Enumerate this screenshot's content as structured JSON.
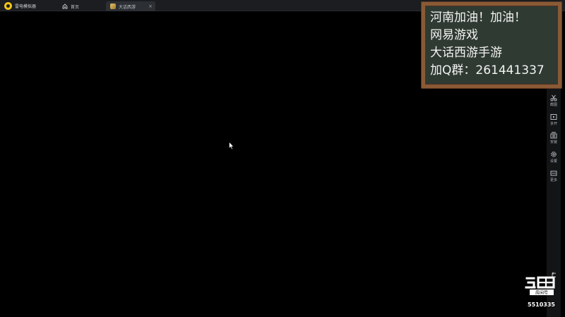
{
  "app": {
    "title": "雷电模拟器",
    "accent": "#f5c518"
  },
  "tabs": [
    {
      "label": "首页",
      "icon": "home-icon",
      "active": false
    },
    {
      "label": "大话西游",
      "icon": "game-icon",
      "active": true,
      "close": "×"
    }
  ],
  "overlay_board": {
    "lines": [
      "河南加油！加油！",
      "网易游戏",
      "大话西游手游",
      "加Q群：261441337"
    ]
  },
  "sidebar": {
    "items": [
      {
        "label": "截图",
        "icon": "scissors-icon"
      },
      {
        "label": "多开",
        "icon": "multi-instance-icon"
      },
      {
        "label": "安装",
        "icon": "install-icon"
      },
      {
        "label": "设置",
        "icon": "gear-icon"
      },
      {
        "label": "更多",
        "icon": "more-icon"
      }
    ],
    "back_icon": "back-icon"
  },
  "watermark": {
    "brand_icon": "douyu-logo-icon",
    "room_label": "房间号",
    "room_number": "5510335"
  }
}
